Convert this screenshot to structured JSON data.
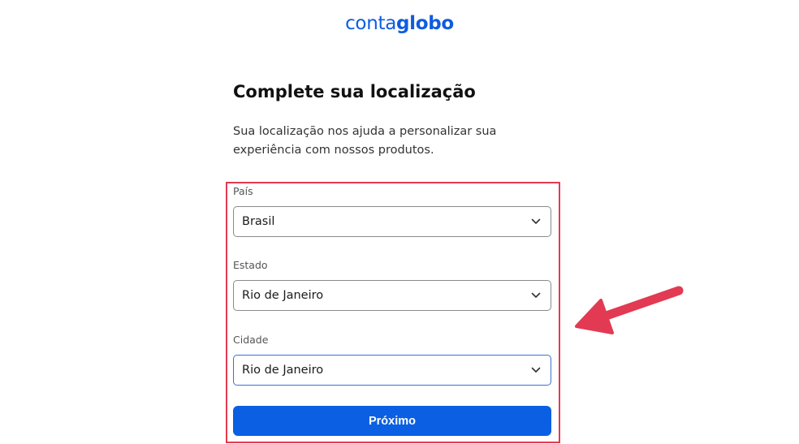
{
  "header": {
    "logo_light": "conta",
    "logo_bold": "globo"
  },
  "main": {
    "title": "Complete sua localização",
    "subtitle": "Sua localização nos ajuda a personalizar sua experiência com nossos produtos."
  },
  "form": {
    "country": {
      "label": "País",
      "value": "Brasil"
    },
    "state": {
      "label": "Estado",
      "value": "Rio de Janeiro"
    },
    "city": {
      "label": "Cidade",
      "value": "Rio de Janeiro"
    },
    "next_label": "Próximo"
  },
  "colors": {
    "brand": "#0f5ce0",
    "button": "#0a5fe3",
    "highlight": "#e23a52"
  },
  "icons": {
    "chevron": "chevron-down-icon",
    "annotation": "arrow-icon"
  }
}
